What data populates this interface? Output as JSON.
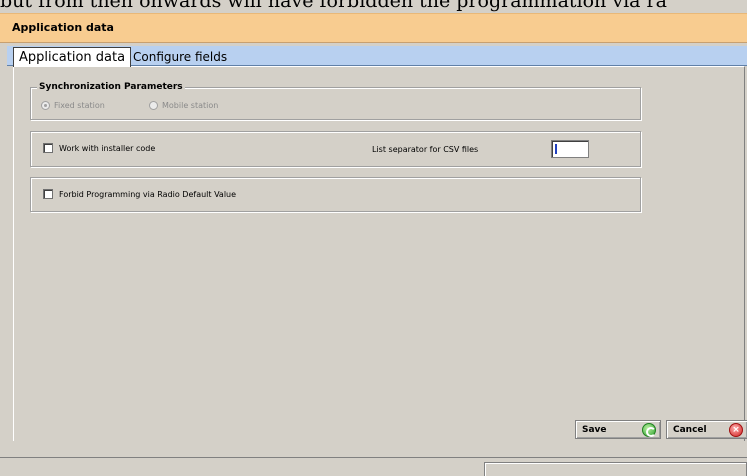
{
  "background_text": "but from then onwards will have forbidden the programmation via ra",
  "window": {
    "title": "Application data"
  },
  "tabs": [
    {
      "label": "Application data",
      "active": true
    },
    {
      "label": "Configure fields",
      "active": false
    }
  ],
  "sync": {
    "title": "Synchronization Parameters",
    "options": [
      {
        "label": "Fixed station",
        "selected": true
      },
      {
        "label": "Mobile station",
        "selected": false
      }
    ]
  },
  "installer": {
    "checkbox_label": "Work with installer code",
    "csv_label": "List separator for CSV files",
    "csv_value": ""
  },
  "radio_programming": {
    "checkbox_label": "Forbid Programming via Radio Default Value"
  },
  "buttons": {
    "save": "Save",
    "cancel": "Cancel"
  },
  "colors": {
    "title_bar": "#f8cc90",
    "tab_strip": "#b8d0f0",
    "panel": "#d4d0c8"
  },
  "icons": {
    "save": "green-ok-icon",
    "cancel": "red-x-icon"
  }
}
